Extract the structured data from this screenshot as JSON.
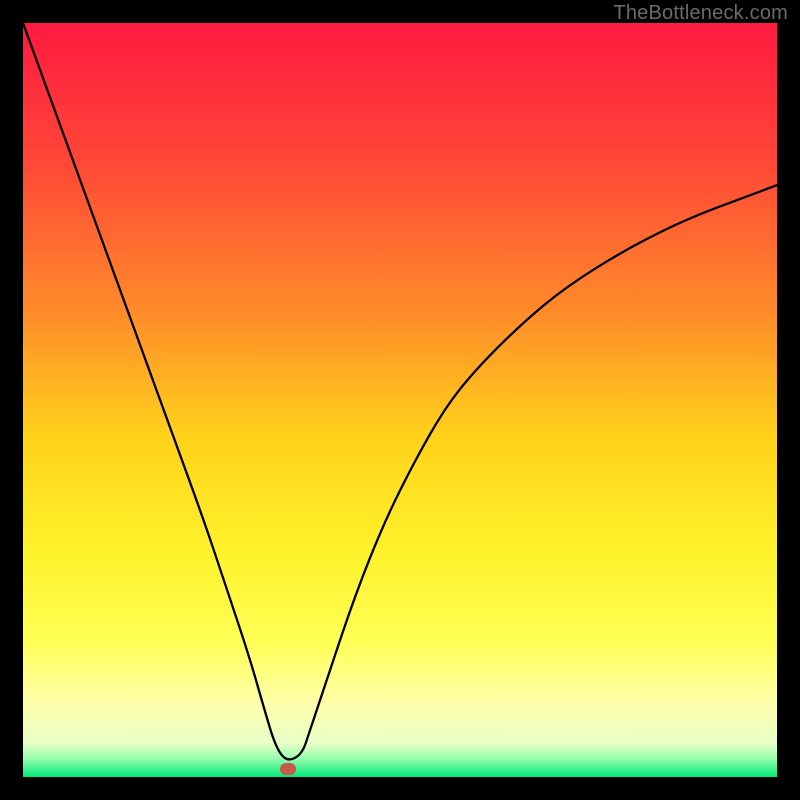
{
  "watermark": "TheBottleneck.com",
  "chart_data": {
    "type": "line",
    "title": "",
    "xlabel": "",
    "ylabel": "",
    "xlim": [
      0,
      100
    ],
    "ylim": [
      0,
      100
    ],
    "grid": false,
    "legend": false,
    "gradient_stops": [
      {
        "offset": 0.0,
        "color": "#ff1a41"
      },
      {
        "offset": 0.18,
        "color": "#ff4637"
      },
      {
        "offset": 0.38,
        "color": "#ff8a2a"
      },
      {
        "offset": 0.55,
        "color": "#ffd21a"
      },
      {
        "offset": 0.7,
        "color": "#fff22a"
      },
      {
        "offset": 0.82,
        "color": "#ffff55"
      },
      {
        "offset": 0.9,
        "color": "#ffffa8"
      },
      {
        "offset": 0.955,
        "color": "#e8ffc8"
      },
      {
        "offset": 0.975,
        "color": "#9affb0"
      },
      {
        "offset": 1.0,
        "color": "#00e878"
      }
    ],
    "series": [
      {
        "name": "bottleneck-curve",
        "color": "#000000",
        "stroke_width": 2.3,
        "x": [
          0,
          4,
          8,
          12,
          16,
          20,
          24,
          27,
          30,
          32,
          33.5,
          35,
          37,
          38,
          40,
          44,
          48,
          52,
          56,
          60,
          66,
          72,
          80,
          88,
          96,
          100
        ],
        "y": [
          100,
          89,
          78,
          67,
          56,
          45,
          34,
          25,
          16,
          9,
          4,
          2,
          3,
          6,
          12,
          24,
          34,
          42,
          49,
          54,
          60,
          65,
          70,
          74,
          77,
          78.5
        ]
      }
    ],
    "marker": {
      "x": 35.2,
      "y": 1.0,
      "color": "#c75a4a"
    }
  }
}
